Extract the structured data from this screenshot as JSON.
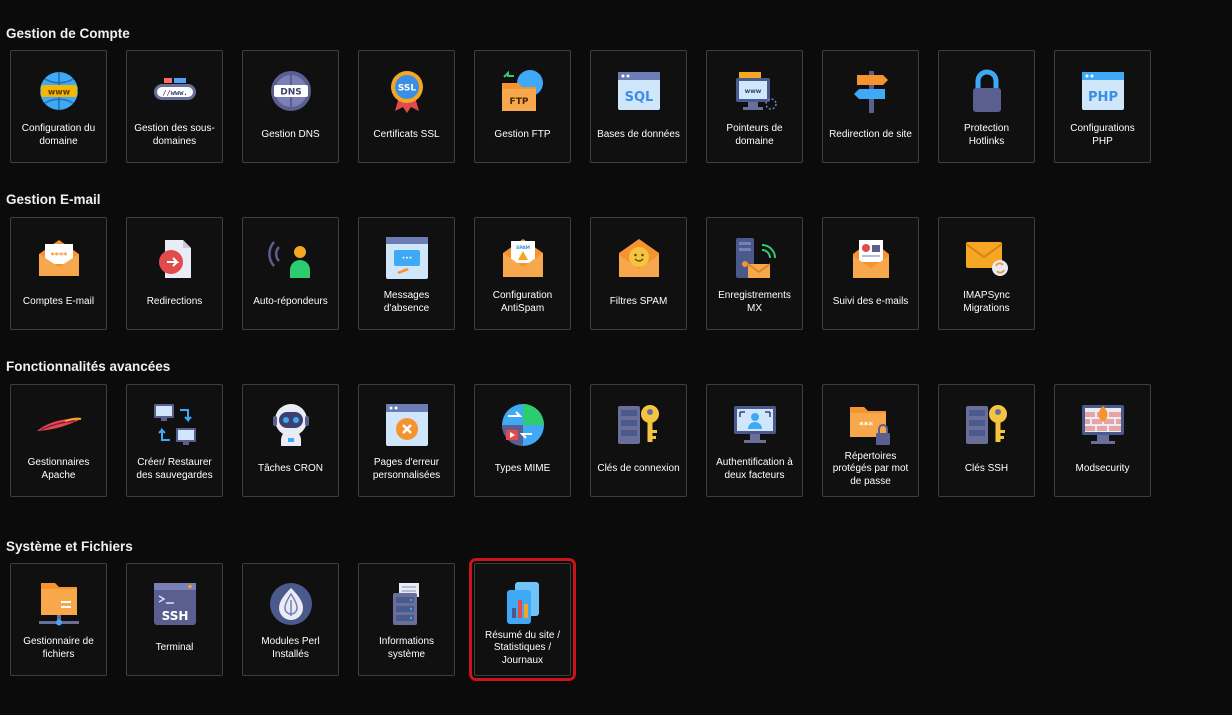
{
  "sections": [
    {
      "title": "Gestion de Compte",
      "items": [
        {
          "label": "Configuration du domaine",
          "icon": "globe-www-icon"
        },
        {
          "label": "Gestion des sous-domaines",
          "icon": "subdomain-bar-icon"
        },
        {
          "label": "Gestion DNS",
          "icon": "dns-globe-icon"
        },
        {
          "label": "Certificats SSL",
          "icon": "ssl-badge-icon"
        },
        {
          "label": "Gestion FTP",
          "icon": "ftp-folder-icon"
        },
        {
          "label": "Bases de données",
          "icon": "sql-window-icon"
        },
        {
          "label": "Pointeurs de domaine",
          "icon": "domain-pointer-icon"
        },
        {
          "label": "Redirection de site",
          "icon": "signpost-icon"
        },
        {
          "label": "Protection Hotlinks",
          "icon": "padlock-icon"
        },
        {
          "label": "Configurations PHP",
          "icon": "php-window-icon"
        }
      ]
    },
    {
      "title": "Gestion E-mail",
      "items": [
        {
          "label": "Comptes E-mail",
          "icon": "email-password-icon"
        },
        {
          "label": "Redirections",
          "icon": "email-redirect-icon"
        },
        {
          "label": "Auto-répondeurs",
          "icon": "auto-responder-icon"
        },
        {
          "label": "Messages d'absence",
          "icon": "absence-message-icon"
        },
        {
          "label": "Configuration AntiSpam",
          "icon": "antispam-envelope-icon"
        },
        {
          "label": "Filtres SPAM",
          "icon": "spam-filter-icon"
        },
        {
          "label": "Enregistrements MX",
          "icon": "mx-server-icon"
        },
        {
          "label": "Suivi des e-mails",
          "icon": "email-tracking-icon"
        },
        {
          "label": "IMAPSync Migrations",
          "icon": "imapsync-icon"
        }
      ]
    },
    {
      "title": "Fonctionnalités avancées",
      "items": [
        {
          "label": "Gestionnaires Apache",
          "icon": "apache-feather-icon"
        },
        {
          "label": "Créer/ Restaurer des sauvegardes",
          "icon": "backup-restore-icon"
        },
        {
          "label": "Tâches CRON",
          "icon": "cron-robot-icon"
        },
        {
          "label": "Pages d'erreur personnalisées",
          "icon": "error-page-icon"
        },
        {
          "label": "Types MIME",
          "icon": "mime-types-icon"
        },
        {
          "label": "Clés de connexion",
          "icon": "server-key-icon"
        },
        {
          "label": "Authentification à deux facteurs",
          "icon": "two-factor-icon"
        },
        {
          "label": "Répertoires protégés par mot de passe",
          "icon": "protected-folder-icon"
        },
        {
          "label": "Clés SSH",
          "icon": "ssh-key-icon"
        },
        {
          "label": "Modsecurity",
          "icon": "firewall-icon"
        }
      ]
    },
    {
      "title": "Système et Fichiers",
      "items": [
        {
          "label": "Gestionnaire de fichiers",
          "icon": "file-manager-icon"
        },
        {
          "label": "Terminal",
          "icon": "ssh-terminal-icon"
        },
        {
          "label": "Modules Perl Installés",
          "icon": "perl-onion-icon"
        },
        {
          "label": "Informations système",
          "icon": "system-info-icon"
        },
        {
          "label": "Résumé du site / Statistiques / Journaux",
          "icon": "site-stats-icon",
          "highlighted": true
        }
      ]
    }
  ]
}
